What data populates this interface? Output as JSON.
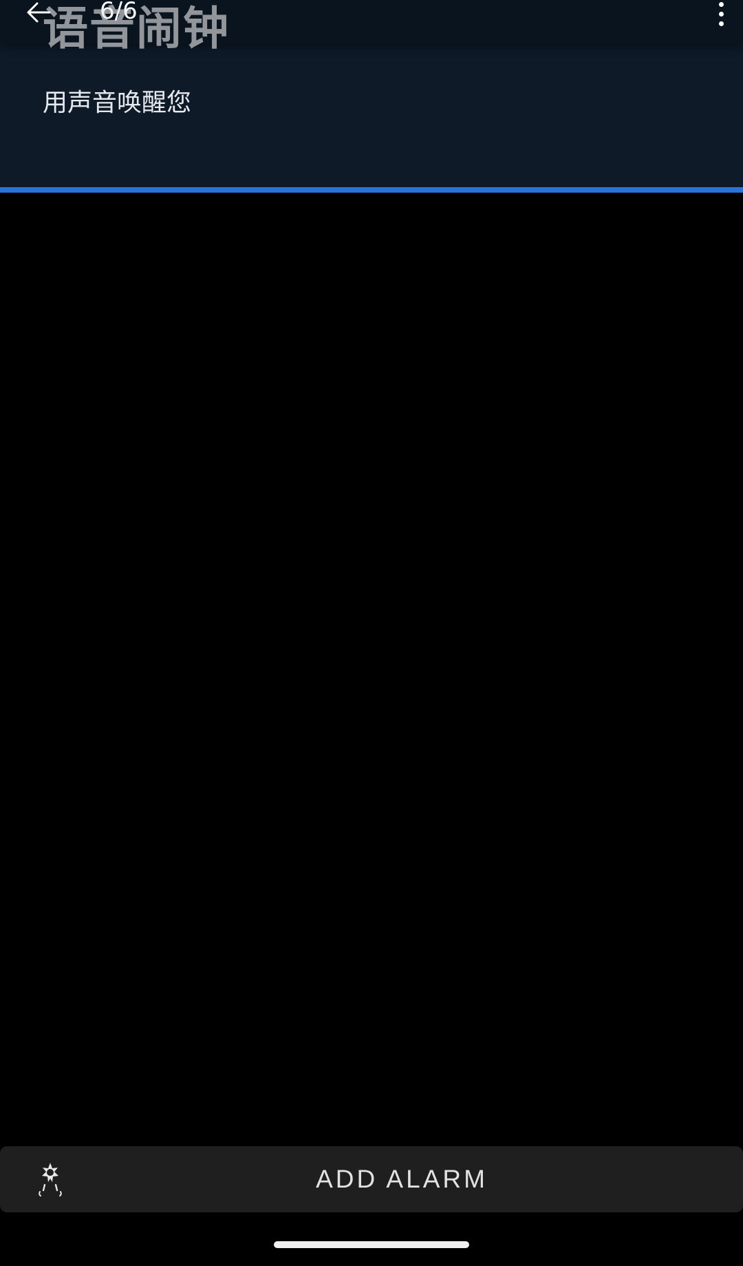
{
  "header": {
    "page_counter": "6/6",
    "title": "语音闹钟",
    "subtitle": "用声音唤醒您",
    "progress_fraction": 1.0
  },
  "bottom_bar": {
    "add_alarm_label": "ADD ALARM",
    "icon": "alarm-star-icon"
  },
  "colors": {
    "header_background": "#0e1a28",
    "progress_accent": "#2a73d8",
    "button_background": "#1f1f1f",
    "page_background": "#000000"
  }
}
